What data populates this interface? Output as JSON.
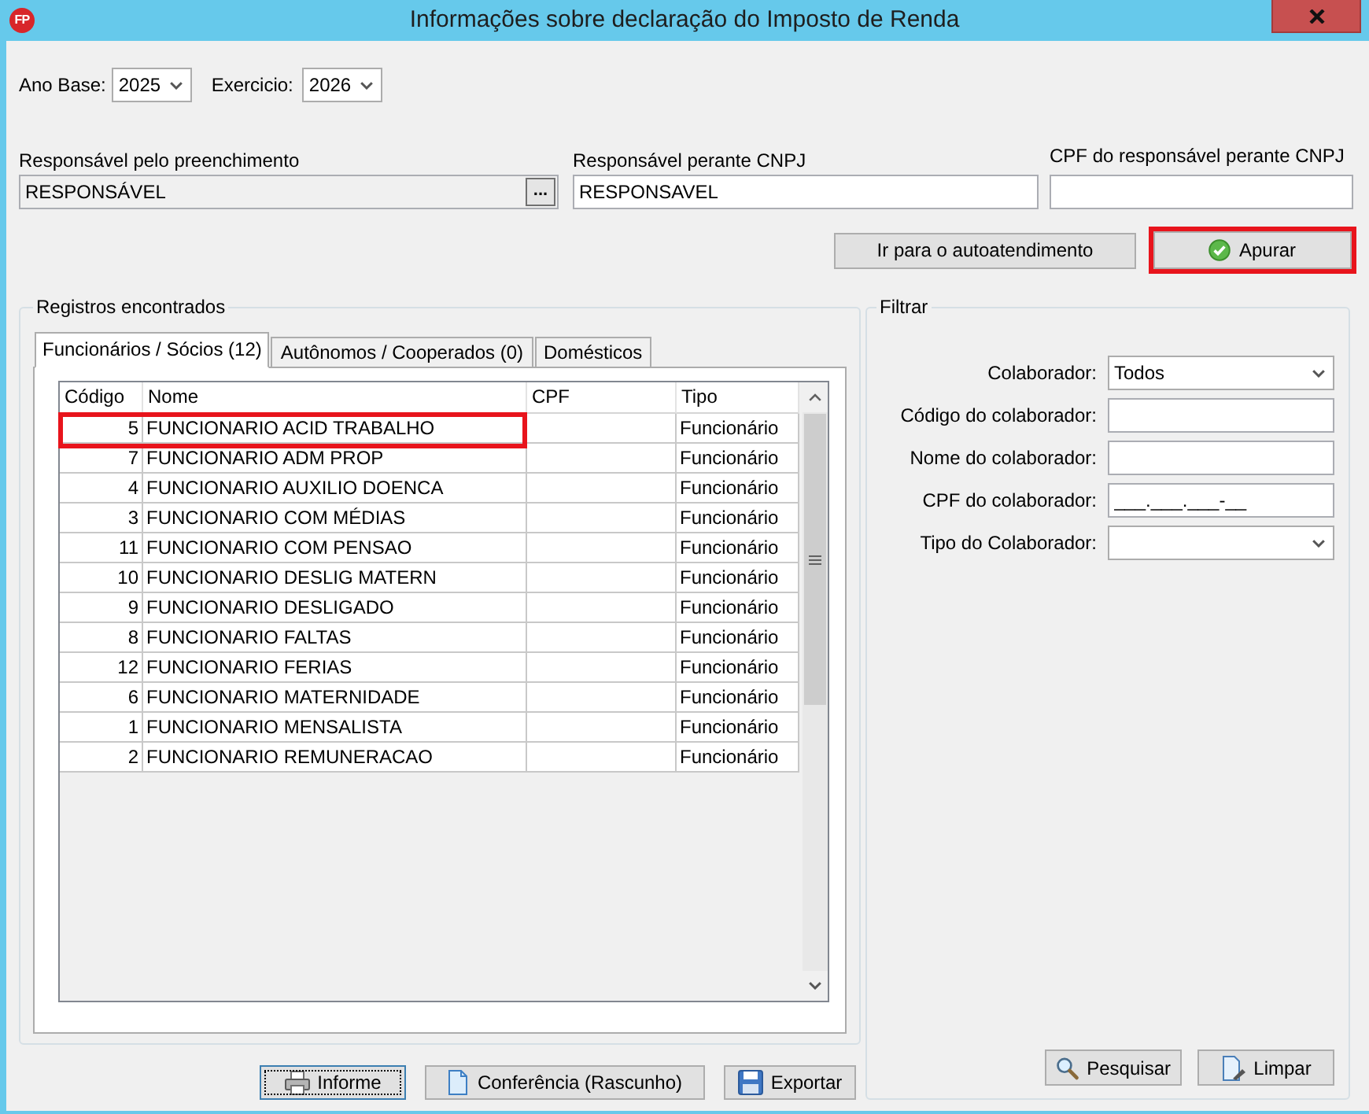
{
  "window": {
    "title": "Informações sobre declaração do Imposto de Renda",
    "logo_text": "FP"
  },
  "period": [
    {
      "label": "Ano Base:",
      "value": "2025"
    },
    {
      "label": "Exercicio:",
      "value": "2026"
    }
  ],
  "responsible": [
    {
      "kind": "lookup",
      "label": "Responsável pelo preenchimento",
      "value": "RESPONSÁVEL",
      "button_label": "..."
    },
    {
      "kind": "text",
      "label": "Responsável perante CNPJ",
      "value": "RESPONSAVEL"
    },
    {
      "kind": "text",
      "label": "CPF do responsável perante CNPJ"
    }
  ],
  "actions": [
    {
      "label": "Ir para o autoatendimento",
      "highlighted": false
    },
    {
      "label": "Apurar",
      "highlighted": true
    }
  ],
  "records": {
    "title": "Registros encontrados",
    "tabs": [
      {
        "label": "Funcionários / Sócios (12)",
        "selected": true
      },
      {
        "label": "Autônomos / Cooperados (0)",
        "selected": false
      },
      {
        "label": "Domésticos",
        "selected": false
      }
    ],
    "table": {
      "columns": [
        "Código",
        "Nome",
        "CPF",
        "Tipo"
      ],
      "rows": [
        {
          "codigo": "5",
          "nome": "FUNCIONARIO ACID TRABALHO",
          "tipo": "Funcionário",
          "highlighted": true
        },
        {
          "codigo": "7",
          "nome": "FUNCIONARIO ADM PROP",
          "tipo": "Funcionário",
          "highlighted": false
        },
        {
          "codigo": "4",
          "nome": "FUNCIONARIO AUXILIO DOENCA",
          "tipo": "Funcionário",
          "highlighted": false
        },
        {
          "codigo": "3",
          "nome": "FUNCIONARIO COM MÉDIAS",
          "tipo": "Funcionário",
          "highlighted": false
        },
        {
          "codigo": "11",
          "nome": "FUNCIONARIO COM PENSAO",
          "tipo": "Funcionário",
          "highlighted": false
        },
        {
          "codigo": "10",
          "nome": "FUNCIONARIO DESLIG MATERN",
          "tipo": "Funcionário",
          "highlighted": false
        },
        {
          "codigo": "9",
          "nome": "FUNCIONARIO DESLIGADO",
          "tipo": "Funcionário",
          "highlighted": false
        },
        {
          "codigo": "8",
          "nome": "FUNCIONARIO FALTAS",
          "tipo": "Funcionário",
          "highlighted": false
        },
        {
          "codigo": "12",
          "nome": "FUNCIONARIO FERIAS",
          "tipo": "Funcionário",
          "highlighted": false
        },
        {
          "codigo": "6",
          "nome": "FUNCIONARIO MATERNIDADE",
          "tipo": "Funcionário",
          "highlighted": false
        },
        {
          "codigo": "1",
          "nome": "FUNCIONARIO MENSALISTA",
          "tipo": "Funcionário",
          "highlighted": false
        },
        {
          "codigo": "2",
          "nome": "FUNCIONARIO REMUNERACAO",
          "tipo": "Funcionário",
          "highlighted": false
        }
      ]
    }
  },
  "export_buttons": [
    {
      "label": "Informe",
      "focused": true
    },
    {
      "label": "Conferência (Rascunho)",
      "focused": false
    },
    {
      "label": "Exportar",
      "focused": false
    }
  ],
  "filter": {
    "title": "Filtrar",
    "fields": [
      {
        "kind": "select",
        "label": "Colaborador:",
        "value": "Todos"
      },
      {
        "kind": "text",
        "label": "Código do colaborador:"
      },
      {
        "kind": "text",
        "label": "Nome do colaborador:"
      },
      {
        "kind": "text",
        "label": "CPF do colaborador:",
        "value": "___.___.___-__"
      },
      {
        "kind": "select",
        "label": "Tipo do Colaborador:"
      }
    ],
    "buttons": [
      {
        "label": "Pesquisar"
      },
      {
        "label": "Limpar"
      }
    ]
  }
}
